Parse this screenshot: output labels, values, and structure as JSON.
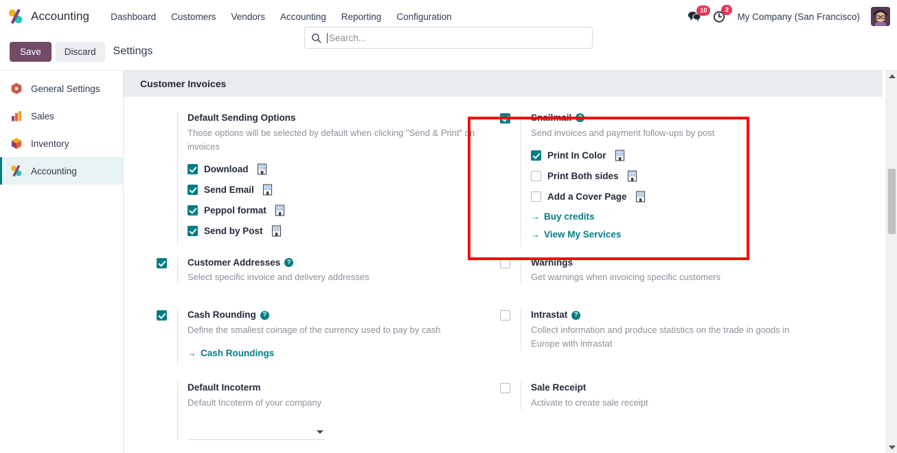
{
  "navbar": {
    "brand": "Accounting",
    "logo_icon": "accounting-app-icon",
    "menu": [
      {
        "label": "Dashboard"
      },
      {
        "label": "Customers"
      },
      {
        "label": "Vendors"
      },
      {
        "label": "Accounting"
      },
      {
        "label": "Reporting"
      },
      {
        "label": "Configuration"
      }
    ],
    "messages_icon": "chat-bubble-icon",
    "messages_count": "10",
    "activities_icon": "clock-icon",
    "activities_count": "2",
    "company": "My Company (San Francisco)",
    "avatar_icon": "user-avatar"
  },
  "controlbar": {
    "save_label": "Save",
    "discard_label": "Discard",
    "title": "Settings"
  },
  "search": {
    "icon": "search-icon",
    "placeholder": "Search..."
  },
  "sidebar": {
    "items": [
      {
        "label": "General Settings",
        "icon": "settings-app-icon",
        "active": false
      },
      {
        "label": "Sales",
        "icon": "sales-app-icon",
        "active": false
      },
      {
        "label": "Inventory",
        "icon": "inventory-app-icon",
        "active": false
      },
      {
        "label": "Accounting",
        "icon": "accounting-app-icon",
        "active": true
      }
    ]
  },
  "section": {
    "title": "Customer Invoices"
  },
  "settings": {
    "default_sending": {
      "title": "Default Sending Options",
      "desc": "Those options will be selected by default when clicking \"Send & Print\" on invoices",
      "options": [
        {
          "label": "Download",
          "checked": true,
          "company_icon": "building-icon"
        },
        {
          "label": "Send Email",
          "checked": true,
          "company_icon": "building-icon"
        },
        {
          "label": "Peppol format",
          "checked": true,
          "company_icon": "building-icon"
        },
        {
          "label": "Send by Post",
          "checked": true,
          "company_icon": "building-icon"
        }
      ]
    },
    "snailmail": {
      "title": "Snailmail",
      "desc": "Send invoices and payment follow-ups by post",
      "checked": true,
      "help_icon": "help-icon",
      "options": [
        {
          "label": "Print In Color",
          "checked": true,
          "company_icon": "building-icon"
        },
        {
          "label": "Print Both sides",
          "checked": false,
          "company_icon": "building-icon"
        },
        {
          "label": "Add a Cover Page",
          "checked": false,
          "company_icon": "building-icon"
        }
      ],
      "links": [
        {
          "label": "Buy credits",
          "arrow": "→"
        },
        {
          "label": "View My Services",
          "arrow": "→"
        }
      ]
    },
    "customer_addresses": {
      "title": "Customer Addresses",
      "desc": "Select specific invoice and delivery addresses",
      "checked": true,
      "help_icon": "help-icon"
    },
    "warnings": {
      "title": "Warnings",
      "desc": "Get warnings when invoicing specific customers",
      "checked": false
    },
    "cash_rounding": {
      "title": "Cash Rounding",
      "desc": "Define the smallest coinage of the currency used to pay by cash",
      "checked": true,
      "help_icon": "help-icon",
      "link": {
        "label": "Cash Roundings",
        "arrow": "→"
      }
    },
    "intrastat": {
      "title": "Intrastat",
      "desc": "Collect information and produce statistics on the trade in goods in Europe with intrastat",
      "checked": false,
      "help_icon": "help-icon"
    },
    "default_incoterm": {
      "title": "Default Incoterm",
      "desc": "Default Incoterm of your company",
      "value": "",
      "dropdown_icon": "chevron-down-icon"
    },
    "sale_receipt": {
      "title": "Sale Receipt",
      "desc": "Activate to create sale receipt",
      "checked": false
    }
  },
  "annotation": {
    "highlight_color": "#ff0000",
    "target": "snailmail-settings-block"
  },
  "colors": {
    "accent_teal": "#017e84",
    "brand_purple": "#714B67",
    "badge_red": "#e2395b"
  }
}
